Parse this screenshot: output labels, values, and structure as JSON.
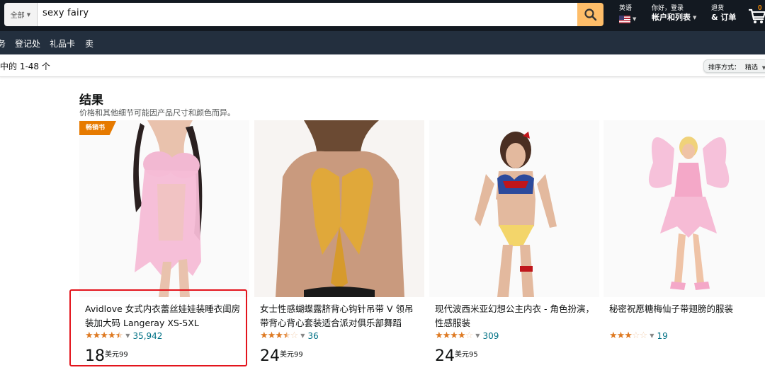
{
  "search": {
    "category": "全部",
    "query": "sexy fairy"
  },
  "header": {
    "language_label": "英语",
    "account_greeting": "你好，登录",
    "account_label": "帐户和列表",
    "returns_top": "退货",
    "returns_bottom": "& 订单"
  },
  "subnav": {
    "items": [
      "务",
      "登记处",
      "礼品卡",
      "卖"
    ]
  },
  "results": {
    "count_text": "中的 1-48 个",
    "sort_label": "排序方式：",
    "sort_value": "精选",
    "heading": "结果",
    "subheading": "价格和其他细节可能因产品尺寸和颜色而异。"
  },
  "products": [
    {
      "badge": "畅销书",
      "title": "Avidlove 女式内衣蕾丝娃娃装睡衣闺房装加大码 Langeray XS-5XL",
      "stars": 4.5,
      "reviews": "35,942",
      "price_whole": "18",
      "price_unit": "美元",
      "price_fraction": "99"
    },
    {
      "title": "女士性感蝴蝶露脐背心钩针吊带 V 领吊带背心背心套装适合派对俱乐部舞蹈",
      "stars": 3.5,
      "reviews": "36",
      "price_whole": "24",
      "price_unit": "美元",
      "price_fraction": "99"
    },
    {
      "title": "现代波西米亚幻想公主内衣 - 角色扮演，性感服装",
      "stars": 4,
      "reviews": "309",
      "price_whole": "24",
      "price_unit": "美元",
      "price_fraction": "95"
    },
    {
      "title": "秘密祝愿糖梅仙子带翅膀的服装",
      "stars": 3,
      "reviews": "19"
    }
  ],
  "colors": {
    "nav_dark": "#131921",
    "subnav": "#232f3e",
    "search_button": "#febd69",
    "badge": "#e67a00",
    "star": "#de7921",
    "link": "#007185",
    "highlight": "#e3141c"
  }
}
